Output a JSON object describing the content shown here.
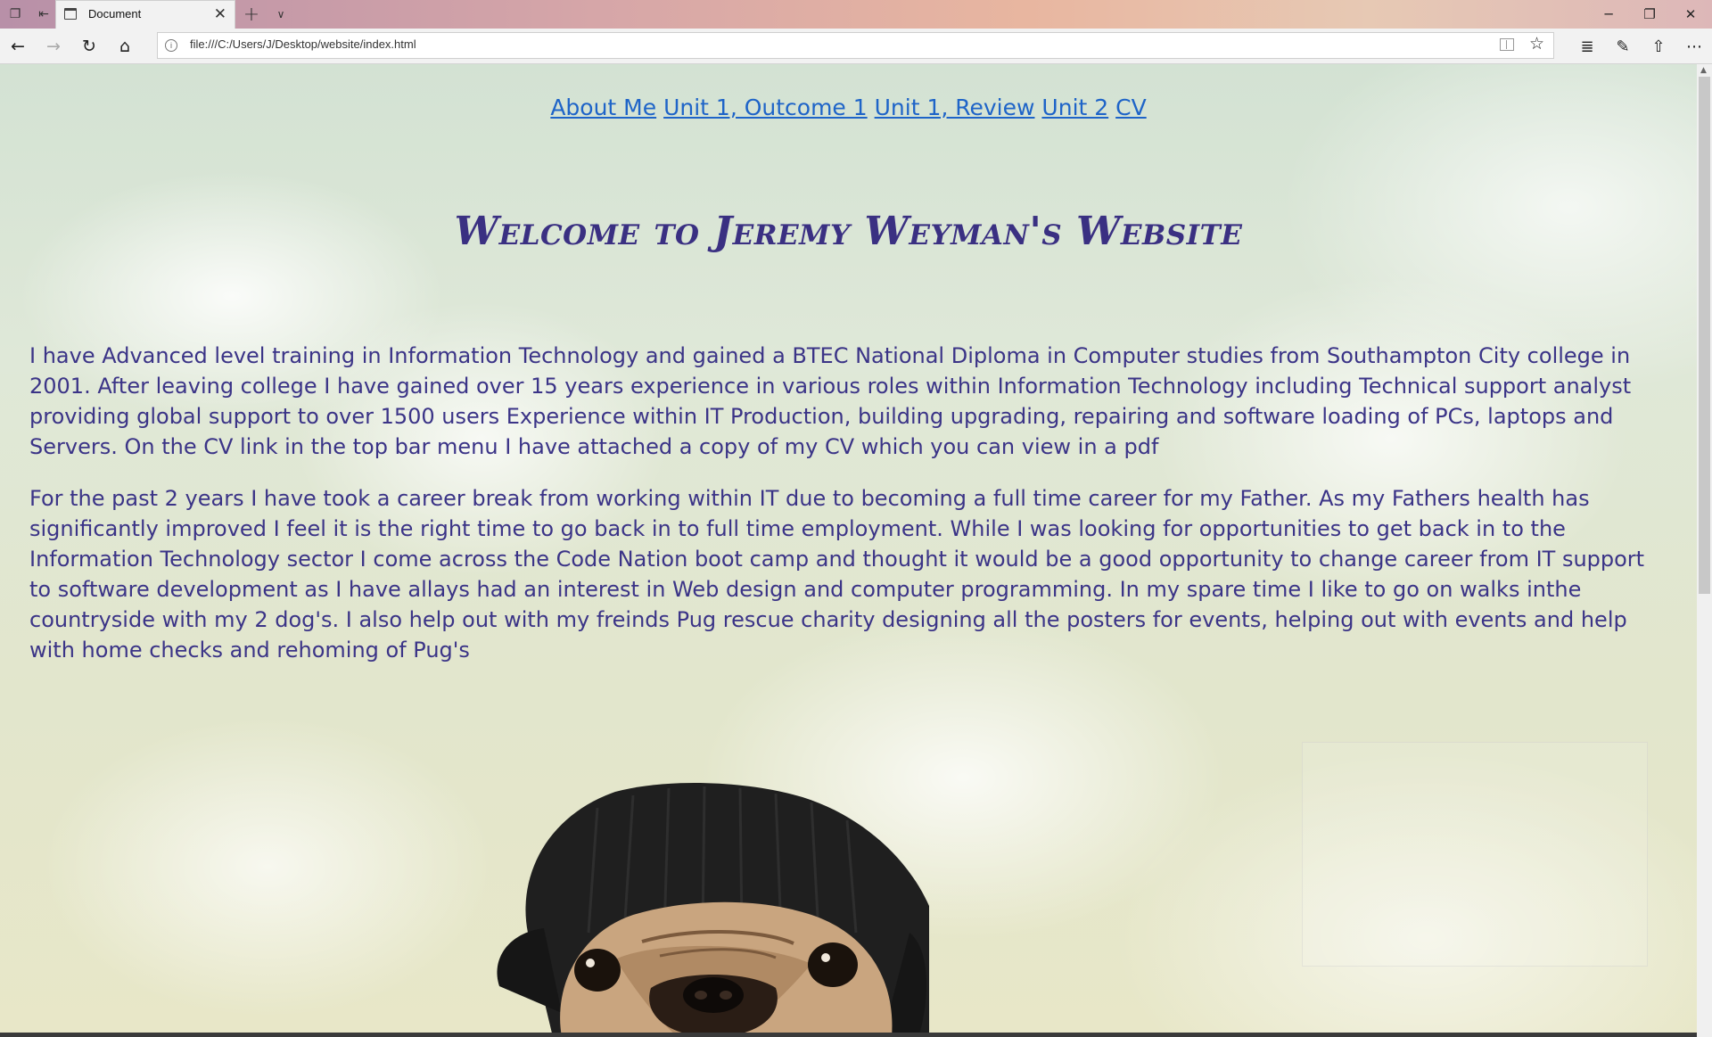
{
  "browser": {
    "tab_title": "Document",
    "tab_icon": "page-icon",
    "address": "file:///C:/Users/J/Desktop/website/index.html",
    "icons": {
      "back": "back-arrow-icon",
      "forward": "forward-arrow-icon",
      "refresh": "refresh-icon",
      "home": "home-icon",
      "favorite": "star-icon",
      "reading_view": "reading-view-icon",
      "favorites_hub": "favorites-hub-icon",
      "notes": "pen-icon",
      "share": "share-icon",
      "more": "more-icon"
    }
  },
  "nav_links": [
    {
      "label": "About Me"
    },
    {
      "label": "Unit 1, Outcome 1"
    },
    {
      "label": "Unit 1, Review"
    },
    {
      "label": "Unit 2"
    },
    {
      "label": "CV"
    }
  ],
  "page": {
    "heading": "Welcome to Jeremy Weyman's Website",
    "paragraph1": "I have Advanced level training in Information Technology and gained a BTEC National Diploma in Computer studies from Southampton City college in 2001. After leaving college I have gained over 15 years experience in various roles within Information Technology including Technical support analyst providing global support to over 1500 users Experience within IT Production, building upgrading, repairing and software loading of PCs, laptops and Servers. On the CV link in the top bar menu I have attached a copy of my CV which you can view in a pdf",
    "paragraph2": "For the past 2 years I have took a career break from working within IT due to becoming a full time career for my Father. As my Fathers health has significantly improved I feel it is the right time to go back in to full time employment. While I was looking for opportunities to get back in to the Information Technology sector I come across the Code Nation boot camp and thought it would be a good opportunity to change career from IT support to software development as I have allays had an interest in Web design and computer programming. In my spare time I like to go on walks inthe countryside with my 2 dog's. I also help out with my freinds Pug rescue charity designing all the posters for events, helping out with events and help with home checks and rehoming of Pug's"
  },
  "colors": {
    "heading": "#3a3082",
    "body_text": "#3b3487",
    "link": "#1e64c8"
  }
}
